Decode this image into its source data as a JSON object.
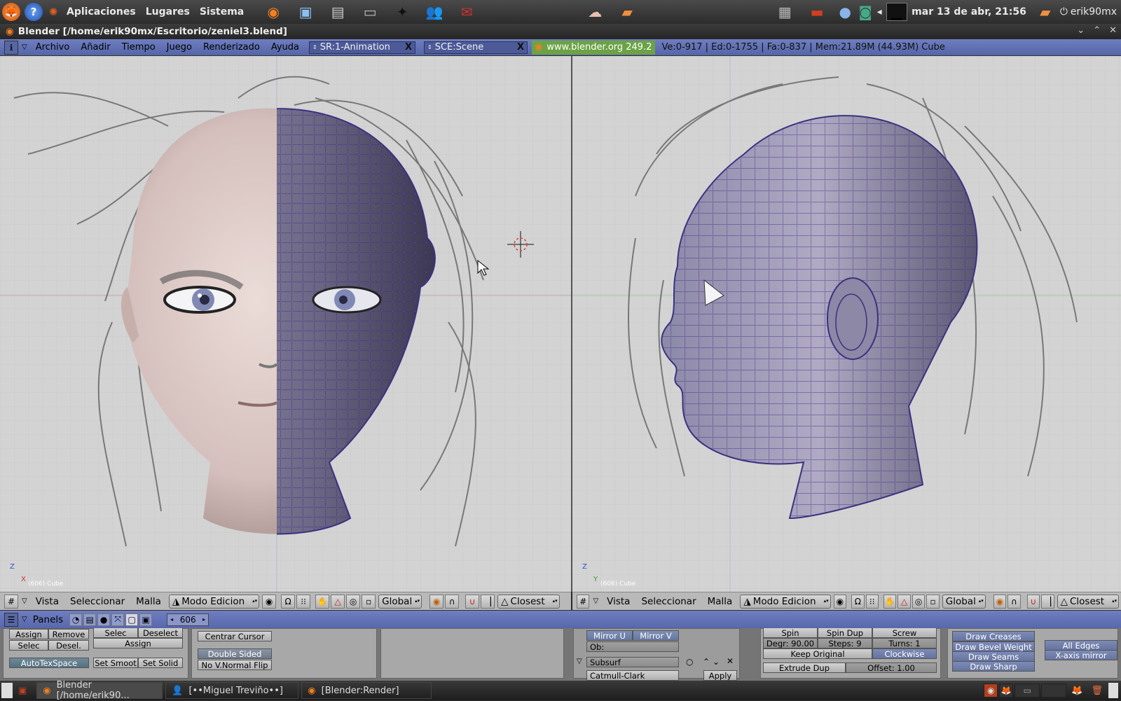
{
  "gnome_panel": {
    "menus": [
      "Aplicaciones",
      "Lugares",
      "Sistema"
    ],
    "clock": "mar 13 de abr, 21:56",
    "user": "erik90mx"
  },
  "window": {
    "title": "Blender [/home/erik90mx/Escritorio/zeniel3.blend]"
  },
  "info_header": {
    "menus": [
      "Archivo",
      "Añadir",
      "Tiempo",
      "Juego",
      "Renderizado",
      "Ayuda"
    ],
    "screen": "SR:1-Animation",
    "scene": "SCE:Scene",
    "website": "www.blender.org 249.2",
    "stats": "Ve:0-917 | Ed:0-1755 | Fa:0-837 | Mem:21.89M (44.93M) Cube"
  },
  "viewports": {
    "left_info": "(606) Cube",
    "right_info": "(606) Cube",
    "left_axes": [
      "Z",
      "X"
    ],
    "right_axes": [
      "Z",
      "Y"
    ]
  },
  "view_header": {
    "menus": [
      "Vista",
      "Seleccionar",
      "Malla"
    ],
    "mode": "Modo Edicion",
    "orientation": "Global",
    "snap": "Closest"
  },
  "buttons_header": {
    "label": "Panels",
    "frame": "606"
  },
  "panels": {
    "vgroup": {
      "assign": "Assign",
      "remove": "Remove",
      "select": "Selec",
      "deselect": "Desel.",
      "autotex": "AutoTexSpace",
      "set_smooth": "Set Smoot",
      "set_solid": "Set Solid"
    },
    "material": {
      "select": "Selec",
      "deselect": "Deselect",
      "assign": "Assign"
    },
    "mesh": {
      "center_cursor": "Centrar Cursor",
      "double_sided": "Double Sided",
      "no_vnormal": "No V.Normal Flip"
    },
    "modifier": {
      "mirror_u": "Mirror U",
      "mirror_v": "Mirror V",
      "ob": "Ob:",
      "subsurf": "Subsurf",
      "type": "Catmull-Clark",
      "apply": "Apply"
    },
    "tools": {
      "spin": "Spin",
      "spin_dup": "Spin Dup",
      "screw": "Screw",
      "degr": "Degr: 90.00",
      "steps": "Steps: 9",
      "turns": "Turns: 1",
      "keep_original": "Keep Original",
      "clockwise": "Clockwise",
      "extrude_dup": "Extrude Dup",
      "offset": "Offset: 1.00"
    },
    "draw": {
      "creases": "Draw Creases",
      "bevel": "Draw Bevel Weight",
      "seams": "Draw Seams",
      "sharp": "Draw Sharp",
      "all_edges": "All Edges",
      "xmirror": "X-axis mirror"
    }
  },
  "taskbar": {
    "tasks": [
      "Blender [/home/erik90...",
      "[••Miguel Treviño••]",
      "[Blender:Render]"
    ]
  },
  "colors": {
    "blender_header": "#6f7ec0",
    "viewport_bg": "#d3d3d3",
    "wire": "#3a3280",
    "vertex": "#b844e0"
  }
}
